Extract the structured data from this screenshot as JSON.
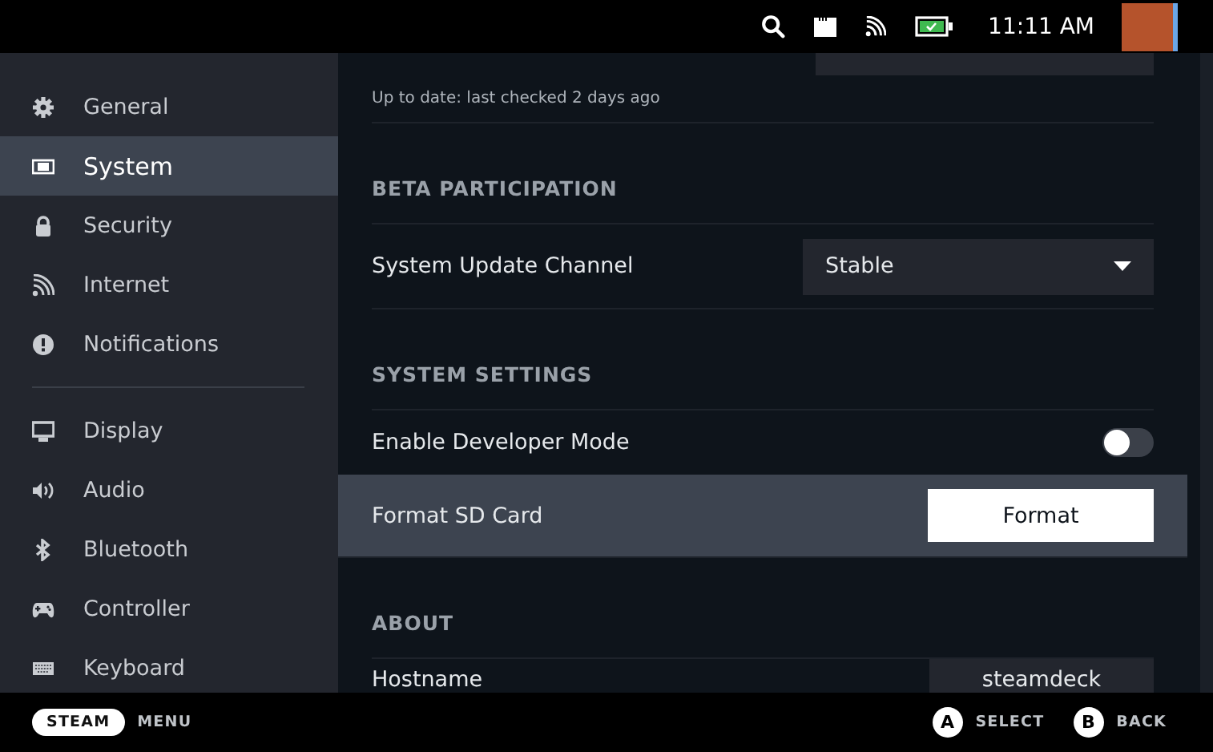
{
  "status_bar": {
    "time": "11:11 AM"
  },
  "sidebar": {
    "groups": [
      [
        {
          "label": "General",
          "selected": false
        },
        {
          "label": "System",
          "selected": true
        },
        {
          "label": "Security",
          "selected": false
        },
        {
          "label": "Internet",
          "selected": false
        },
        {
          "label": "Notifications",
          "selected": false
        }
      ],
      [
        {
          "label": "Display",
          "selected": false
        },
        {
          "label": "Audio",
          "selected": false
        },
        {
          "label": "Bluetooth",
          "selected": false
        },
        {
          "label": "Controller",
          "selected": false
        },
        {
          "label": "Keyboard",
          "selected": false
        }
      ]
    ]
  },
  "content": {
    "update_status": "Up to date: last checked 2 days ago",
    "sections": [
      {
        "title": "BETA PARTICIPATION",
        "rows": [
          {
            "kind": "dropdown",
            "label": "System Update Channel",
            "value": "Stable",
            "focused": false
          }
        ]
      },
      {
        "title": "SYSTEM SETTINGS",
        "rows": [
          {
            "kind": "toggle",
            "label": "Enable Developer Mode",
            "on": false,
            "focused": false
          },
          {
            "kind": "button",
            "label": "Format SD Card",
            "value": "Format",
            "focused": true
          }
        ]
      },
      {
        "title": "ABOUT",
        "rows": [
          {
            "kind": "value",
            "label": "Hostname",
            "value": "steamdeck",
            "focused": false
          }
        ]
      }
    ]
  },
  "footer": {
    "steam": "STEAM",
    "menu": "MENU",
    "actions": [
      {
        "key": "A",
        "label": "SELECT"
      },
      {
        "key": "B",
        "label": "BACK"
      }
    ]
  }
}
